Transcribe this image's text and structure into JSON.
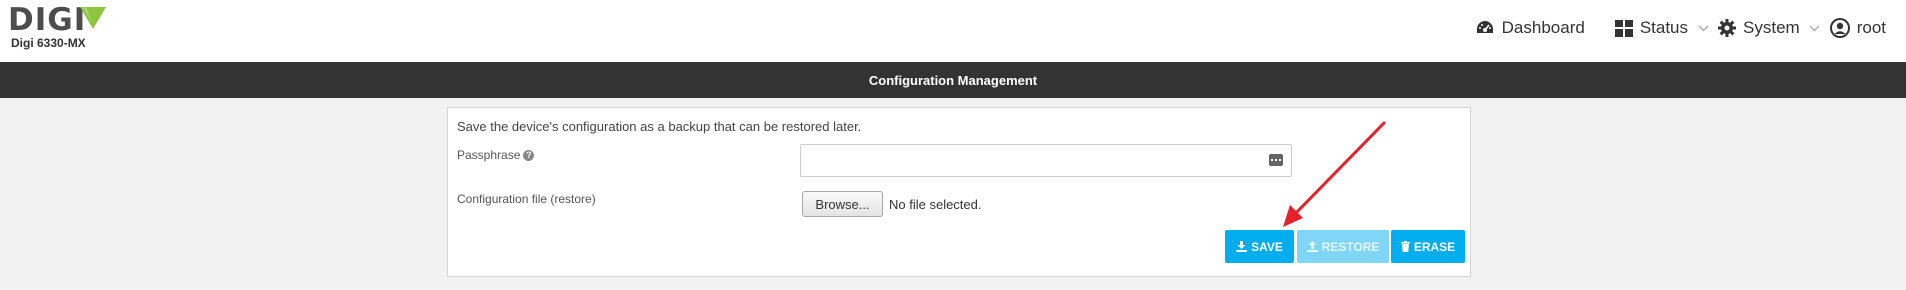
{
  "header": {
    "brand": "DIGI",
    "model": "Digi 6330-MX",
    "nav": {
      "dashboard": "Dashboard",
      "status": "Status",
      "system": "System",
      "user": "root"
    }
  },
  "page": {
    "title": "Configuration Management",
    "description": "Save the device's configuration as a backup that can be restored later.",
    "passphrase_label": "Passphrase",
    "passphrase_value": "",
    "config_file_label": "Configuration file (restore)",
    "browse_label": "Browse...",
    "no_file_text": "No file selected.",
    "buttons": {
      "save": "SAVE",
      "restore": "RESTORE",
      "erase": "ERASE"
    }
  },
  "colors": {
    "accent": "#00aeef",
    "accent_disabled": "#7fd6f7",
    "titlebar": "#333333",
    "logo_green": "#8cc63f",
    "annotation_arrow": "#e8202a"
  },
  "icons": {
    "logo": "digi-logo-icon",
    "dashboard": "dashboard-gauge-icon",
    "status": "grid-icon",
    "system": "gear-icon",
    "user": "user-icon",
    "help": "question-circle-icon",
    "keyboard": "keyboard-icon",
    "save": "download-icon",
    "restore": "upload-icon",
    "erase": "trash-icon"
  }
}
